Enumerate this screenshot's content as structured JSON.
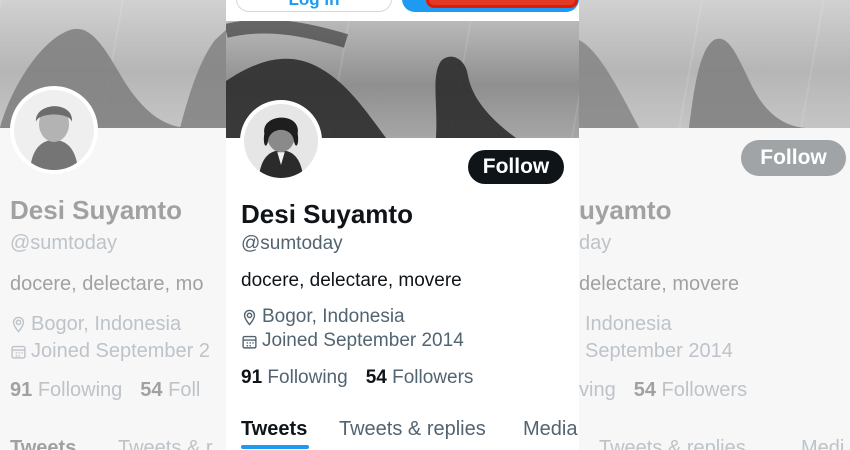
{
  "profile": {
    "name": "Desi Suyamto",
    "handle": "@sumtoday",
    "bio": "docere, delectare, movere",
    "location": "Bogor, Indonesia",
    "joined": "Joined September 2014",
    "following_count": "91",
    "following_label": "Following",
    "followers_count": "54",
    "followers_label": "Followers"
  },
  "top_bar": {
    "login_label": "Log in"
  },
  "actions": {
    "follow_label": "Follow"
  },
  "tabs": [
    {
      "label": "Tweets",
      "active": true
    },
    {
      "label": "Tweets & replies"
    },
    {
      "label": "Media"
    }
  ],
  "left_panel": {
    "name": "Desi Suyamto",
    "handle": "@sumtoday",
    "bio": "docere, delectare, mo",
    "location": "Bogor, Indonesia",
    "joined": "Joined September 2",
    "following_count": "91",
    "following_label": "Following",
    "followers_count": "54",
    "followers_label": "Foll",
    "tab1": "Tweets",
    "tab2": "Tweets & r"
  },
  "right_panel": {
    "name": "uyamto",
    "handle": "day",
    "bio": "delectare, movere",
    "location": "Indonesia",
    "joined": "September 2014",
    "following_label": "ving",
    "followers_count": "54",
    "followers_label": "Followers",
    "tab2": "Tweets & replies",
    "tab3": "Medi",
    "follow_label": "Follow"
  },
  "colors": {
    "accent": "#1d9bf0",
    "highlight": "#e11b0c",
    "follow_dark": "#0f1419",
    "follow_faded": "#6e7377"
  }
}
